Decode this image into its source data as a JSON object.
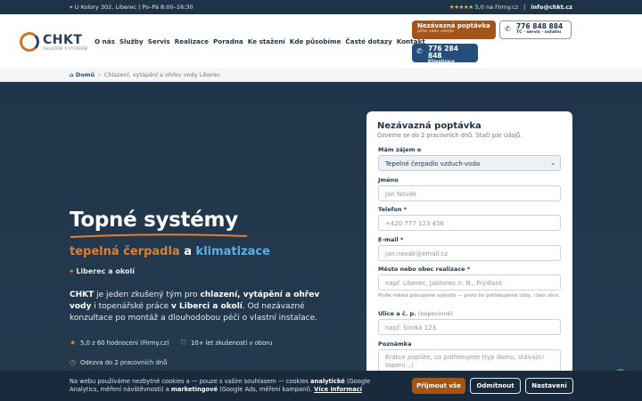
{
  "topbar": {
    "address": "U Kolory 302, Liberec",
    "separator": "|",
    "hours": "Po–Pá 8:00–16:30",
    "stars": "★★★★★",
    "rating": "5,0 na Firmy.cz",
    "email": "info@chkt.cz"
  },
  "logo": {
    "name": "CHKT",
    "sub": "CHLAZENÍ A VYTÁPĚNÍ"
  },
  "nav": [
    "O nás",
    "Služby",
    "Servis",
    "Realizace",
    "Poradna",
    "Ke stažení",
    "Kde působíme",
    "Časté dotazy",
    "Kontakt"
  ],
  "cta": {
    "label": "Nezávazná poptávka",
    "sub": "pište nebo volejte"
  },
  "phone1": {
    "number": "776 848 884",
    "sub": "TČ · servis · ostatní"
  },
  "phone2": {
    "number": "776 284 848",
    "sub": "Klimatizace"
  },
  "breadcrumb": {
    "home": "Domů",
    "sep": "›",
    "current": "Chlazení, vytápění a ohřev vody Liberec"
  },
  "hero": {
    "title": "Topné systémy",
    "sub_a": "tepelná čerpadla",
    "sub_and": " a ",
    "sub_b": "klimatizace",
    "location": "Liberec a okolí",
    "desc_parts": [
      "CHKT",
      " je jeden zkušený tým pro ",
      "chlazení, vytápění a ohřev vody",
      " i topenářské práce ",
      "v Liberci a okolí",
      ". Od nezávazné konzultace po montáž a dlouhodobou péči o vlastní instalace."
    ],
    "features": [
      "5,0 z 60 hodnocení (Firmy.cz)",
      "10+ let zkušeností v oboru",
      "Odezva do 2 pracovních dnů"
    ]
  },
  "form": {
    "title": "Nezávazná poptávka",
    "subtitle": "Ozveme se do 2 pracovních dnů. Stačí pár údajů.",
    "interest_label": "Mám zájem o",
    "interest_value": "Tepelné čerpadlo vzduch-voda",
    "name_label": "Jméno",
    "name_ph": "Jan Novák",
    "phone_label": "Telefon *",
    "phone_ph": "+420 777 123 456",
    "email_label": "E-mail *",
    "email_ph": "jan.novak@email.cz",
    "city_label": "Město nebo obec realizace *",
    "city_ph": "např. Liberec, Jablonec n. N., Frýdlant",
    "city_hint": "Podle města plánujeme výjezdy — proto ho potřebujeme vždy, i bez ulice.",
    "street_label": "Ulice a č. p.",
    "street_opt": "(nepovinné)",
    "street_ph": "např. Široká 123",
    "note_label": "Poznámka",
    "note_ph": "Krátce popište, co potřebujete (typ domu, stávající topení...)"
  },
  "cookie": {
    "parts": [
      "Na webu používáme nezbytné cookies a — pouze s vaším souhlasem — cookies ",
      "analytické",
      " (Google Analytics, měření návštěvnosti) a ",
      "marketingové",
      " (Google Ads, měření kampaní). ",
      "Více informací"
    ],
    "accept": "Přijmout vše",
    "reject": "Odmítnout",
    "settings": "Nastavení"
  },
  "colors": {
    "accent": "#a45416",
    "navy": "#1d3346",
    "blue": "#234f7a",
    "orange": "#e07f2f",
    "light_blue": "#5ab0e8"
  }
}
